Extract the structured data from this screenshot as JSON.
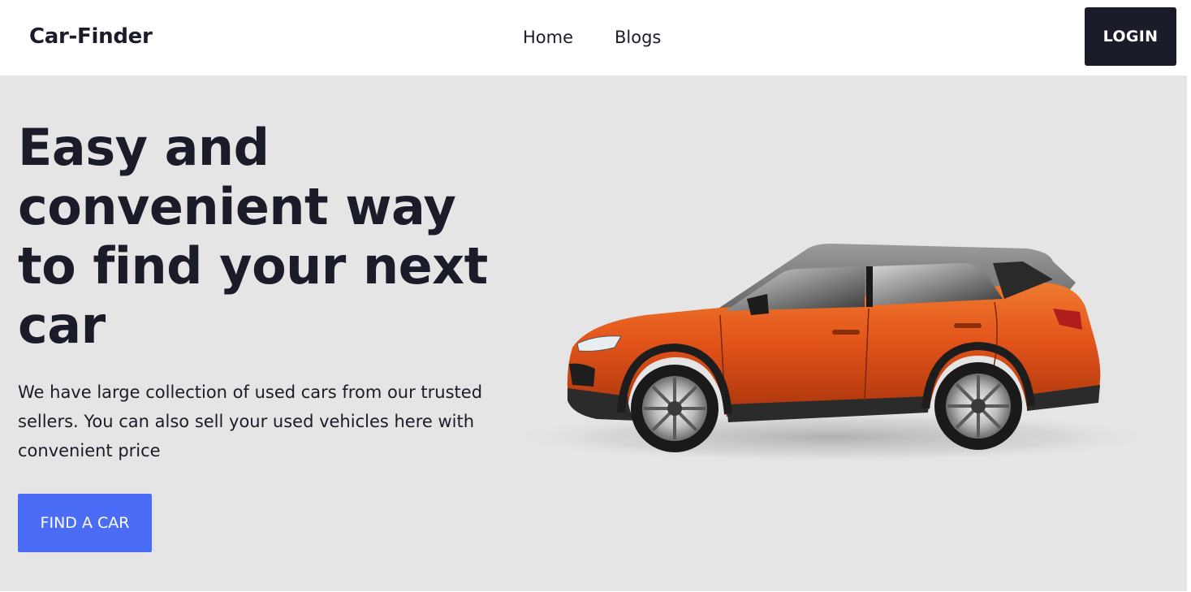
{
  "navbar": {
    "brand": "Car-Finder",
    "links": [
      "Home",
      "Blogs"
    ],
    "login_label": "LOGIN"
  },
  "hero": {
    "title": "Easy and convenient way to find your next car",
    "description": "We have large collection of used cars from our trusted sellers. You can also sell your used vehicles here with convenient price",
    "cta_label": "FIND A CAR",
    "image": "orange-suv-car-image"
  },
  "colors": {
    "text_dark": "#1b1c2a",
    "hero_bg": "#e5e5e6",
    "cta_blue": "#4a6cf7",
    "login_bg": "#1b1c2a",
    "car_orange": "#e2531a"
  }
}
